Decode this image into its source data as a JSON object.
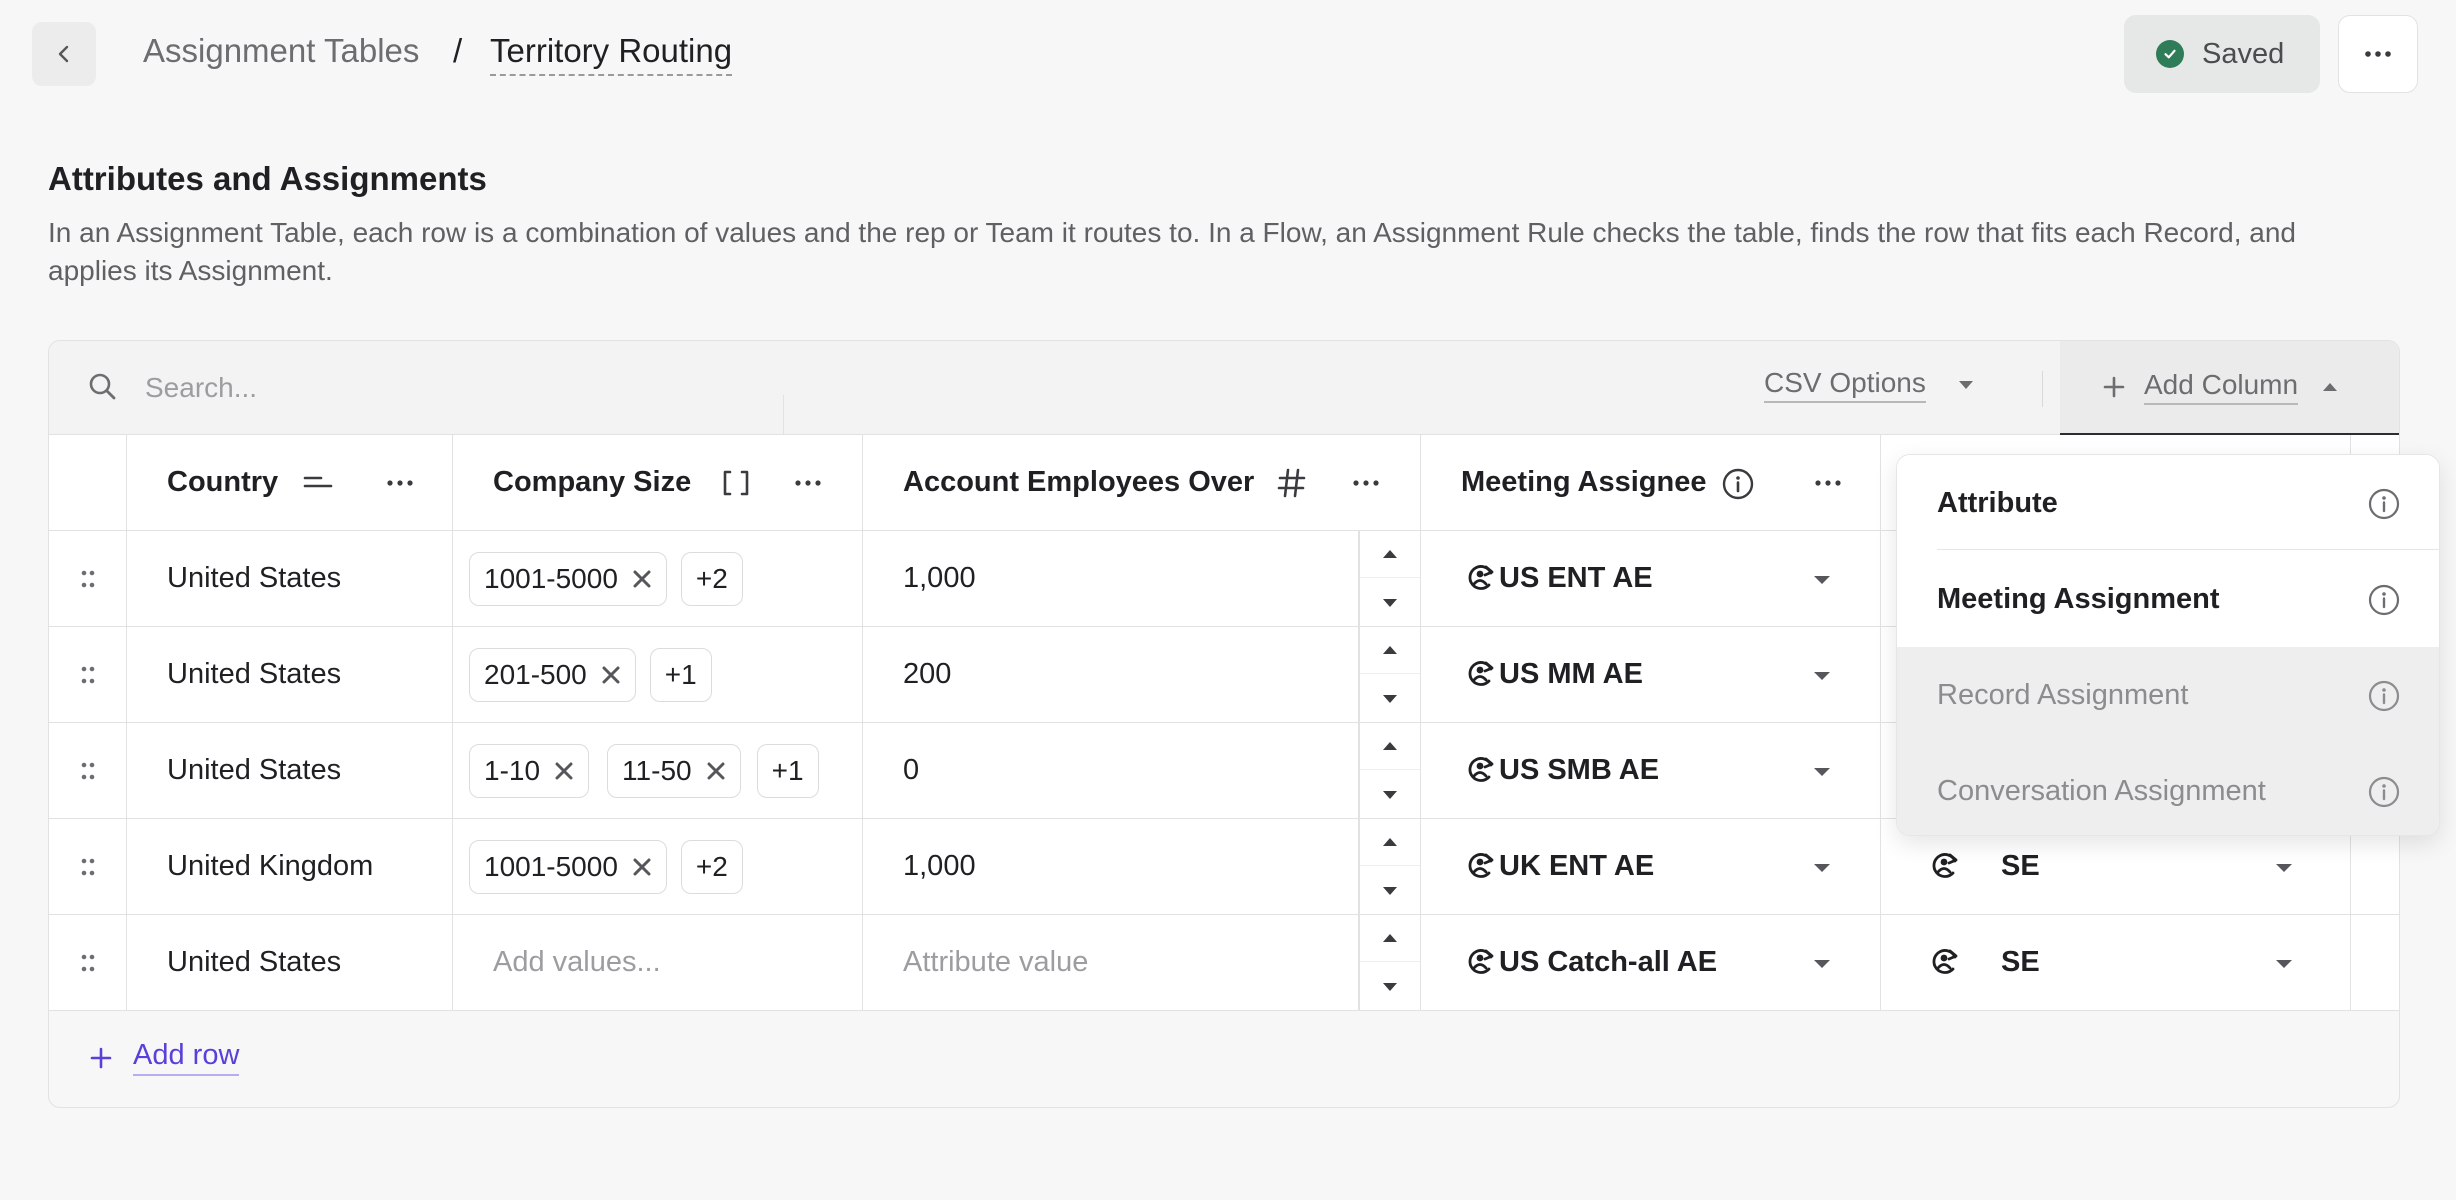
{
  "header": {
    "breadcrumb_parent": "Assignment Tables",
    "breadcrumb_separator": "/",
    "breadcrumb_current": "Territory Routing",
    "status_label": "Saved"
  },
  "section": {
    "title": "Attributes and Assignments",
    "description": "In an Assignment Table, each row is a combination of values and the rep or Team it routes to. In a Flow, an Assignment Rule checks the table, finds the row that fits each Record, and applies its Assignment."
  },
  "toolbar": {
    "search_placeholder": "Search...",
    "csv_options_label": "CSV Options",
    "add_column_label": "Add Column"
  },
  "columns": {
    "country": "Country",
    "company_size": "Company Size",
    "employees": "Account Employees Over",
    "meeting_assignee": "Meeting Assignee"
  },
  "rows": [
    {
      "country": "United States",
      "sizes": [
        "1001-5000"
      ],
      "more": "+2",
      "employees": "1,000",
      "assignee": "US ENT AE",
      "second": ""
    },
    {
      "country": "United States",
      "sizes": [
        "201-500"
      ],
      "more": "+1",
      "employees": "200",
      "assignee": "US MM AE",
      "second": ""
    },
    {
      "country": "United States",
      "sizes": [
        "1-10",
        "11-50"
      ],
      "more": "+1",
      "employees": "0",
      "assignee": "US SMB AE",
      "second": ""
    },
    {
      "country": "United Kingdom",
      "sizes": [
        "1001-5000"
      ],
      "more": "+2",
      "employees": "1,000",
      "assignee": "UK ENT AE",
      "second": "SE"
    },
    {
      "country": "United States",
      "sizes_placeholder": "Add values...",
      "employees_placeholder": "Attribute value",
      "assignee": "US Catch-all AE",
      "second": "SE"
    }
  ],
  "menu": {
    "items": [
      {
        "label": "Attribute",
        "enabled": true
      },
      {
        "label": "Meeting Assignment",
        "enabled": true
      },
      {
        "label": "Record Assignment",
        "enabled": false
      },
      {
        "label": "Conversation Assignment",
        "enabled": false
      }
    ]
  },
  "add_row_label": "Add row",
  "colors": {
    "accent": "#5b3fd9",
    "saved_check": "#2f7d58"
  }
}
